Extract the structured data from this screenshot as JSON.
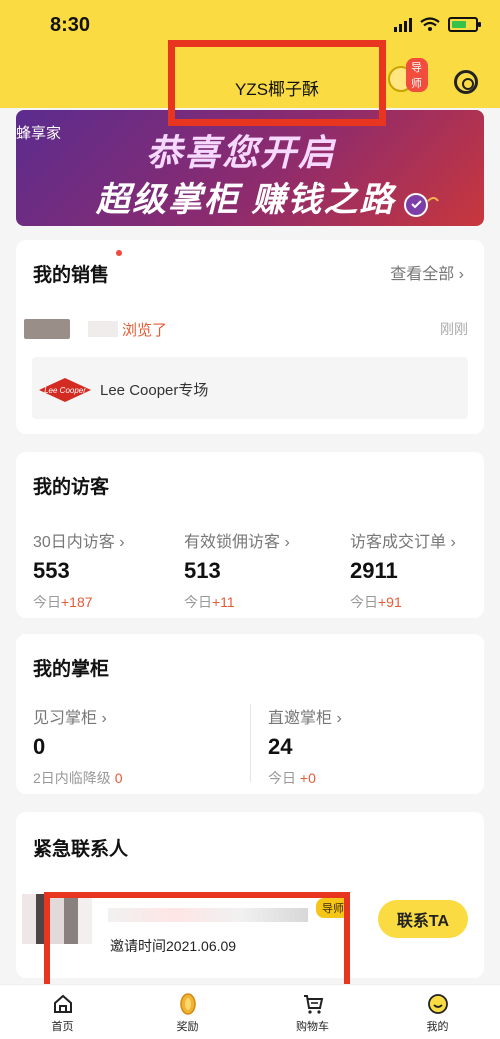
{
  "status_bar": {
    "time": "8:30"
  },
  "header": {
    "title": "YZS椰子酥",
    "mentor_tag": "导师"
  },
  "banner": {
    "brand": "蜂享家",
    "line1": "恭喜您开启",
    "line2": "超级掌柜 赚钱之路"
  },
  "sales": {
    "title": "我的销售",
    "view_all": "查看全部 ›",
    "activity_text": "浏览了",
    "activity_time": "刚刚",
    "brand_name": "Lee Cooper专场",
    "brand_logo_text": "Lee Cooper"
  },
  "visitors": {
    "title": "我的访客",
    "stats": [
      {
        "label": "30日内访客 ›",
        "value": "553",
        "today_prefix": "今日",
        "today_delta": "+187"
      },
      {
        "label": "有效锁佣访客 ›",
        "value": "513",
        "today_prefix": "今日",
        "today_delta": "+11"
      },
      {
        "label": "访客成交订单 ›",
        "value": "2911",
        "today_prefix": "今日",
        "today_delta": "+91"
      }
    ]
  },
  "shopkeeper": {
    "title": "我的掌柜",
    "stats": [
      {
        "label": "见习掌柜 ›",
        "value": "0",
        "note_prefix": "2日内临降级 ",
        "note_delta": "0"
      },
      {
        "label": "直邀掌柜 ›",
        "value": "24",
        "note_prefix": "今日 ",
        "note_delta": "+0"
      }
    ]
  },
  "emergency": {
    "title": "紧急联系人",
    "mentor_tag": "导师",
    "contact_button": "联系TA",
    "invite_text": "邀请时间2021.06.09"
  },
  "tabbar": {
    "tabs": [
      {
        "label": "首页",
        "icon": "home-icon"
      },
      {
        "label": "奖励",
        "icon": "coin-icon"
      },
      {
        "label": "购物车",
        "icon": "cart-icon"
      },
      {
        "label": "我的",
        "icon": "smiley-icon"
      }
    ]
  },
  "colors": {
    "brand_yellow": "#fadb42",
    "accent_red": "#e55b36",
    "annotation_red": "#e8351f"
  }
}
